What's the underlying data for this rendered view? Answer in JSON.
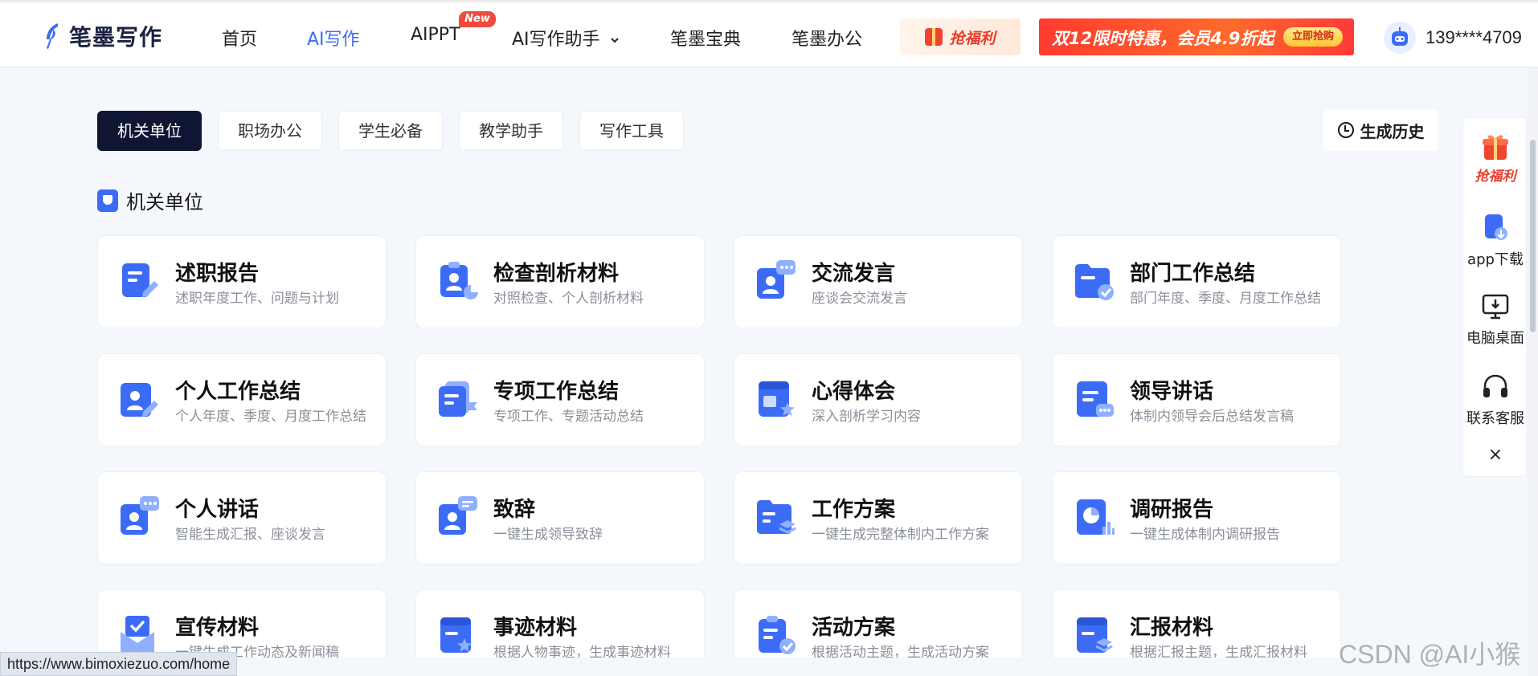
{
  "brand": {
    "name": "笔墨写作",
    "accent": "#3c6cf5"
  },
  "nav": {
    "items": [
      {
        "label": "首页",
        "active": false
      },
      {
        "label": "AI写作",
        "active": true
      },
      {
        "label": "AIPPT",
        "active": false,
        "badge": "New"
      },
      {
        "label": "AI写作助手",
        "active": false,
        "dropdown": true
      },
      {
        "label": "笔墨宝典",
        "active": false
      },
      {
        "label": "笔墨办公",
        "active": false
      }
    ],
    "promo_welfare": "抢福利",
    "promo_banner": "双12限时特惠，会员4.9折起",
    "promo_button": "立即抢购",
    "user_phone": "139****4709"
  },
  "tabs": [
    {
      "label": "机关单位",
      "active": true
    },
    {
      "label": "职场办公",
      "active": false
    },
    {
      "label": "学生必备",
      "active": false
    },
    {
      "label": "教学助手",
      "active": false
    },
    {
      "label": "写作工具",
      "active": false
    }
  ],
  "history_button": "生成历史",
  "section_title": "机关单位",
  "cards": [
    {
      "title": "述职报告",
      "subtitle": "述职年度工作、问题与计划",
      "icon": "document-pen-icon"
    },
    {
      "title": "检查剖析材料",
      "subtitle": "对照检查、个人剖析材料",
      "icon": "clipboard-user-icon"
    },
    {
      "title": "交流发言",
      "subtitle": "座谈会交流发言",
      "icon": "user-chat-icon"
    },
    {
      "title": "部门工作总结",
      "subtitle": "部门年度、季度、月度工作总结",
      "icon": "folder-check-icon"
    },
    {
      "title": "个人工作总结",
      "subtitle": "个人年度、季度、月度工作总结",
      "icon": "user-pen-icon"
    },
    {
      "title": "专项工作总结",
      "subtitle": "专项工作、专题活动总结",
      "icon": "document-flag-icon"
    },
    {
      "title": "心得体会",
      "subtitle": "深入剖析学习内容",
      "icon": "book-star-icon"
    },
    {
      "title": "领导讲话",
      "subtitle": "体制内领导会后总结发言稿",
      "icon": "document-chat-icon"
    },
    {
      "title": "个人讲话",
      "subtitle": "智能生成汇报、座谈发言",
      "icon": "user-chat-icon"
    },
    {
      "title": "致辞",
      "subtitle": "一键生成领导致辞",
      "icon": "user-message-icon"
    },
    {
      "title": "工作方案",
      "subtitle": "一键生成完整体制内工作方案",
      "icon": "folder-layers-icon"
    },
    {
      "title": "调研报告",
      "subtitle": "一键生成体制内调研报告",
      "icon": "pie-chart-icon"
    },
    {
      "title": "宣传材料",
      "subtitle": "一键生成工作动态及新闻稿",
      "icon": "envelope-check-icon"
    },
    {
      "title": "事迹材料",
      "subtitle": "根据人物事迹，生成事迹材料",
      "icon": "book-star-icon"
    },
    {
      "title": "活动方案",
      "subtitle": "根据活动主题，生成活动方案",
      "icon": "clipboard-check-icon"
    },
    {
      "title": "汇报材料",
      "subtitle": "根据汇报主题，生成汇报材料",
      "icon": "book-layers-icon"
    }
  ],
  "sidebar": {
    "items": [
      {
        "label": "抢福利",
        "icon": "gift-icon"
      },
      {
        "label": "app下载",
        "icon": "phone-download-icon"
      },
      {
        "label": "电脑桌面",
        "icon": "monitor-download-icon"
      },
      {
        "label": "联系客服",
        "icon": "headset-icon"
      }
    ],
    "close": "×"
  },
  "status_url": "https://www.bimoxiezuo.com/home",
  "watermark": "CSDN @AI小猴"
}
